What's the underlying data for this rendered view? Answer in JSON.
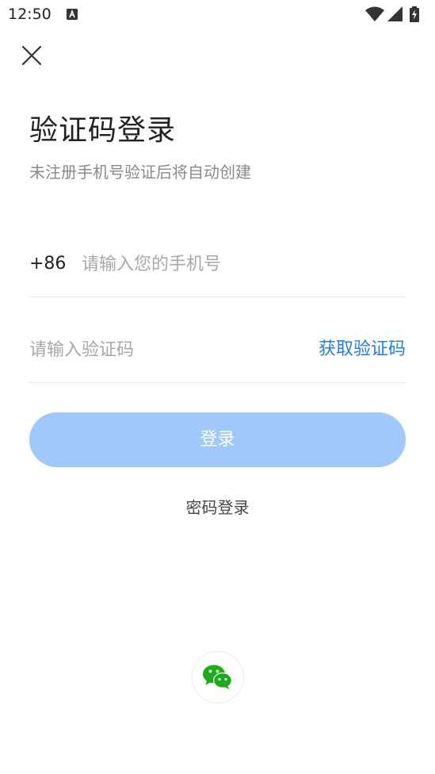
{
  "status_bar": {
    "time": "12:50",
    "notification_icon": "a-icon",
    "icons": [
      "wifi-icon",
      "cellular-signal-icon",
      "battery-charging-icon"
    ]
  },
  "header": {
    "close_icon": "close-icon"
  },
  "login": {
    "title": "验证码登录",
    "subtitle": "未注册手机号验证后将自动创建",
    "country_code": "+86",
    "phone_placeholder": "请输入您的手机号",
    "code_placeholder": "请输入验证码",
    "get_code_label": "获取验证码",
    "login_button_label": "登录",
    "password_login_label": "密码登录"
  },
  "third_party": {
    "wechat_icon": "wechat-icon"
  },
  "colors": {
    "accent": "#1e7df2",
    "login_button_disabled": "#a0c8fb",
    "wechat_green": "#1aad19"
  }
}
